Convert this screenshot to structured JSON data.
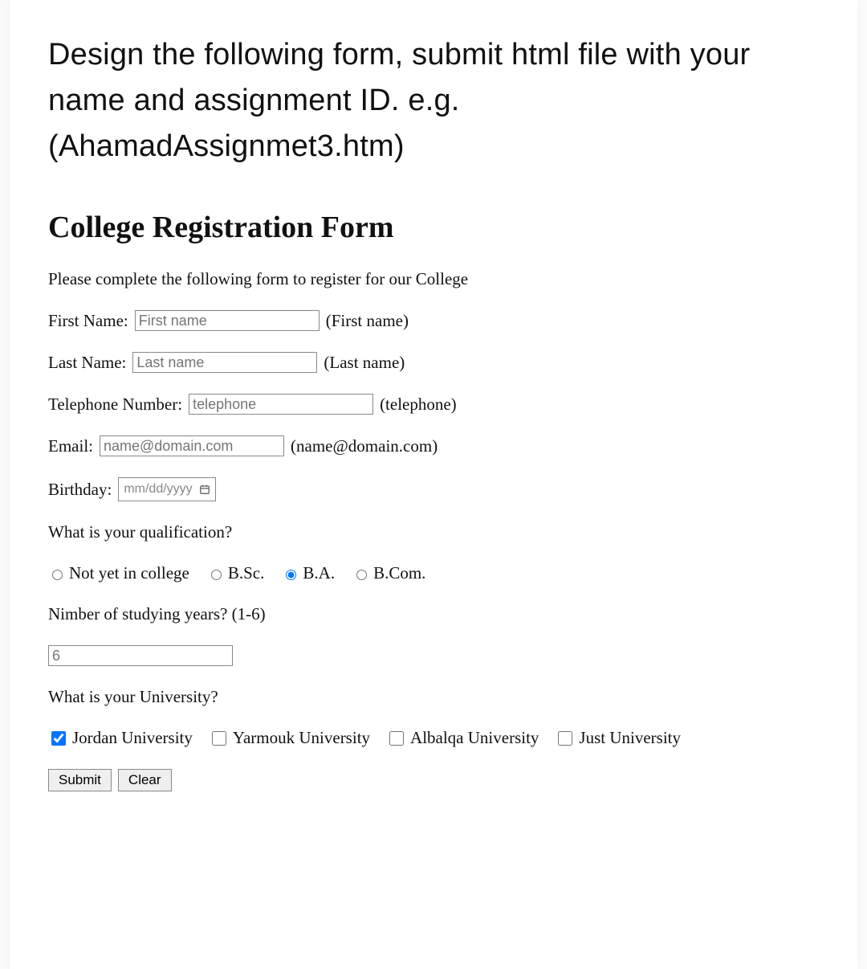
{
  "instructions": "Design the following form, submit html file with your name and assignment ID. e.g. (AhamadAssignmet3.htm)",
  "form": {
    "title": "College Registration Form",
    "intro": "Please complete the following form to register for our College",
    "first_name": {
      "label": "First Name:",
      "placeholder": "First name",
      "hint": "(First name)"
    },
    "last_name": {
      "label": "Last Name:",
      "placeholder": "Last name",
      "hint": "(Last name)"
    },
    "telephone": {
      "label": "Telephone Number:",
      "placeholder": "telephone",
      "hint": "(telephone)"
    },
    "email": {
      "label": "Email:",
      "placeholder": "name@domain.com",
      "hint": "(name@domain.com)"
    },
    "birthday": {
      "label": "Birthday:",
      "placeholder": "mm/dd/yyyy"
    },
    "qualification": {
      "label": "What is your qualification?",
      "options": [
        {
          "label": "Not yet in college",
          "selected": false
        },
        {
          "label": "B.Sc.",
          "selected": false
        },
        {
          "label": "B.A.",
          "selected": true
        },
        {
          "label": "B.Com.",
          "selected": false
        }
      ]
    },
    "years": {
      "label": "Nimber of studying years? (1-6)",
      "value": "6"
    },
    "university": {
      "label": "What is your University?",
      "options": [
        {
          "label": "Jordan University",
          "checked": true
        },
        {
          "label": "Yarmouk University",
          "checked": false
        },
        {
          "label": "Albalqa University",
          "checked": false
        },
        {
          "label": "Just University",
          "checked": false
        }
      ]
    },
    "buttons": {
      "submit": "Submit",
      "clear": "Clear"
    }
  }
}
